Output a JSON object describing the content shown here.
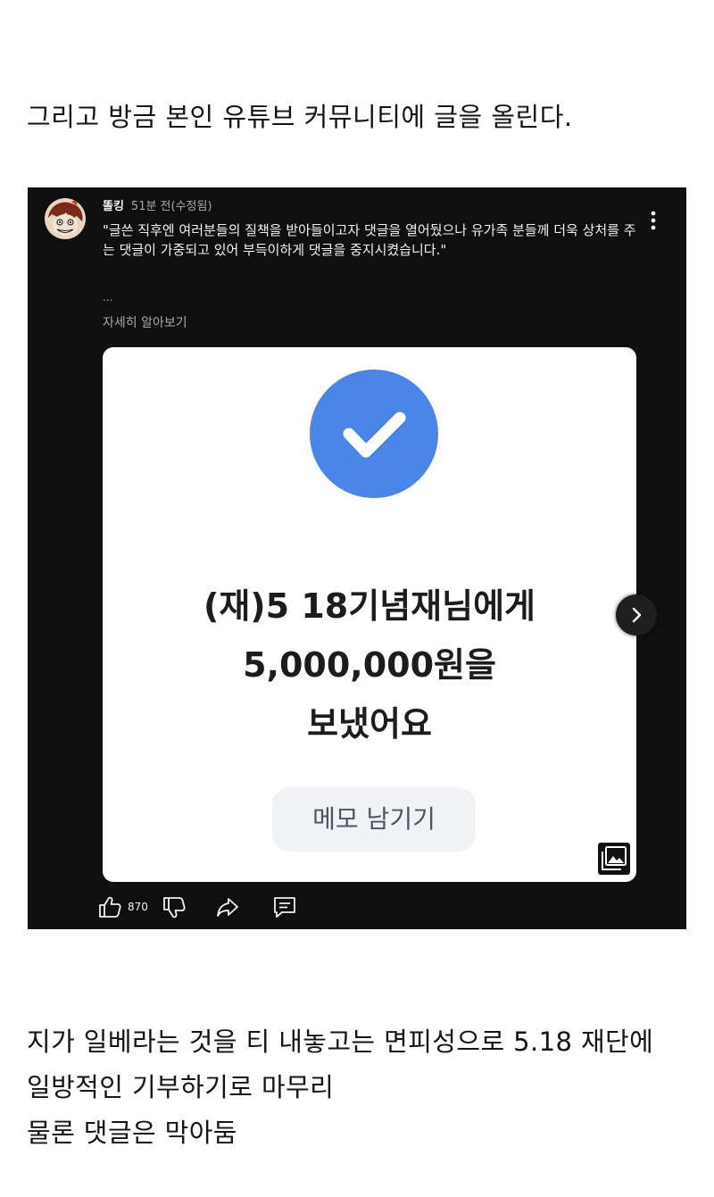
{
  "intro_text": "그리고 방금 본인 유튜브 커뮤니티에 글을 올린다.",
  "post": {
    "author": "똘킹",
    "time": "51분 전(수정됨)",
    "text": "\"글쓴 직후엔 여러분들의 질책을 받아들이고자 댓글을 열어뒀으나 유가족 분들께 더욱 상처를 주는 댓글이 가중되고 있어 부득이하게 댓글을 중지시켰습니다.\"",
    "ellipsis": "...",
    "read_more": "자세히 알아보기",
    "like_count": "870"
  },
  "card": {
    "line1": "(재)5 18기념재님에게",
    "line2": "5,000,000원을",
    "line3": "보냈어요",
    "memo_button": "메모 남기기"
  },
  "closing": {
    "line1": "지가 일베라는 것을 티 내놓고는 면피성으로 5.18 재단에",
    "line2": "일방적인 기부하기로 마무리",
    "line3": "물론 댓글은 막아둠"
  },
  "icons": {
    "avatar": "avatar",
    "more": "more-vertical-icon",
    "check": "check-circle-icon",
    "next": "chevron-right-icon",
    "gallery": "gallery-icon",
    "like": "thumb-up-icon",
    "dislike": "thumb-down-icon",
    "share": "share-icon",
    "comment": "comment-icon"
  },
  "colors": {
    "post_background": "#0f0f0f",
    "check_blue": "#4a86e8",
    "card_background": "#ffffff"
  }
}
